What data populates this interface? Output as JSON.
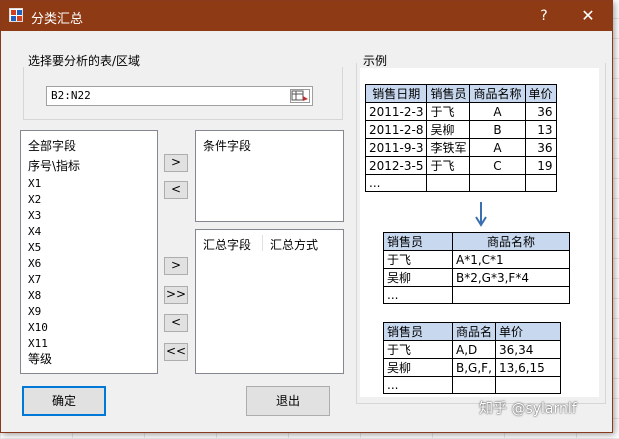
{
  "window": {
    "title": "分类汇总",
    "help_label": "?",
    "close_label": "✕"
  },
  "range_section": {
    "label": "选择要分析的表/区域",
    "value": "B2:N22"
  },
  "all_fields": {
    "header": "全部字段",
    "items": [
      "序号\\指标",
      "X1",
      "X2",
      "X3",
      "X4",
      "X5",
      "X6",
      "X7",
      "X8",
      "X9",
      "X10",
      "X11",
      "等级"
    ]
  },
  "condition_fields": {
    "header": "条件字段"
  },
  "summary_fields": {
    "col1": "汇总字段",
    "col2": "汇总方式"
  },
  "buttons": {
    "add_condition": ">",
    "remove_condition": "<",
    "add_summary": ">",
    "add_all_summary": ">>",
    "remove_summary": "<",
    "remove_all_summary": "<<",
    "ok": "确定",
    "exit": "退出"
  },
  "example": {
    "label": "示例",
    "table1": {
      "headers": [
        "销售日期",
        "销售员",
        "商品名称",
        "单价"
      ],
      "rows": [
        [
          "2011-2-3",
          "于飞",
          "A",
          "36"
        ],
        [
          "2011-2-8",
          "吴柳",
          "B",
          "13"
        ],
        [
          "2011-9-3",
          "李铁军",
          "A",
          "36"
        ],
        [
          "2012-3-5",
          "于飞",
          "C",
          "19"
        ],
        [
          "...",
          "",
          "",
          ""
        ]
      ]
    },
    "table2": {
      "headers": [
        "销售员",
        "商品名称"
      ],
      "rows": [
        [
          "于飞",
          "A*1,C*1"
        ],
        [
          "吴柳",
          "B*2,G*3,F*4"
        ],
        [
          "...",
          ""
        ]
      ]
    },
    "table3": {
      "headers": [
        "销售员",
        "商品名",
        "单价"
      ],
      "rows": [
        [
          "于飞",
          "A,D",
          "36,34"
        ],
        [
          "吴柳",
          "B,G,F,",
          "13,6,15"
        ],
        [
          "...",
          "",
          ""
        ]
      ]
    }
  },
  "watermark": "知乎 @sylarnlf"
}
